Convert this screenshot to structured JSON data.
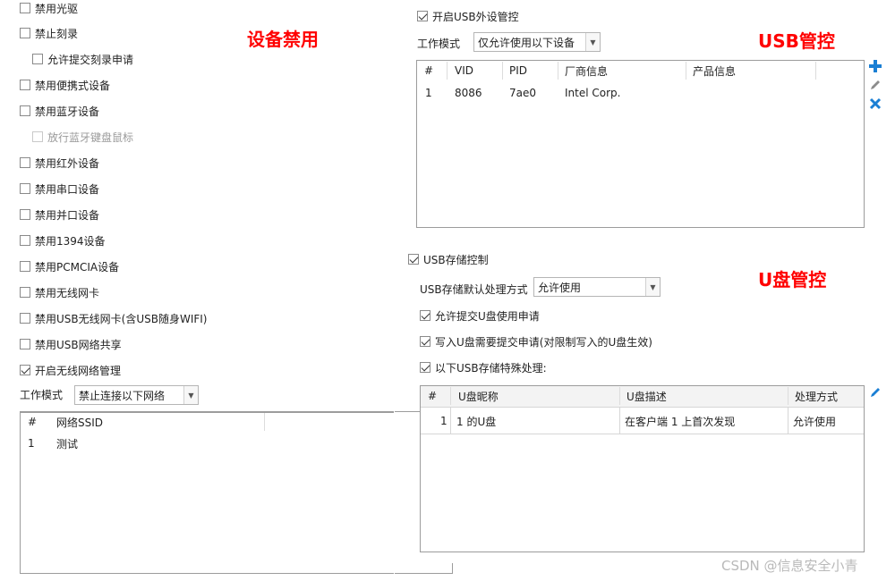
{
  "titles": {
    "device_disable": "设备禁用",
    "usb_control": "USB管控",
    "udisk_control": "U盘管控",
    "colors": {
      "title": "#ff0000",
      "accent_icon": "#1a7fd4"
    }
  },
  "left_checkboxes": [
    {
      "label": "禁用光驱",
      "checked": false,
      "disabled": false
    },
    {
      "label": "禁止刻录",
      "checked": false,
      "disabled": false
    },
    {
      "label": "允许提交刻录申请",
      "checked": false,
      "disabled": false
    },
    {
      "label": "禁用便携式设备",
      "checked": false,
      "disabled": false
    },
    {
      "label": "禁用蓝牙设备",
      "checked": false,
      "disabled": false
    },
    {
      "label": "放行蓝牙键盘鼠标",
      "checked": false,
      "disabled": true
    },
    {
      "label": "禁用红外设备",
      "checked": false,
      "disabled": false
    },
    {
      "label": "禁用串口设备",
      "checked": false,
      "disabled": false
    },
    {
      "label": "禁用并口设备",
      "checked": false,
      "disabled": false
    },
    {
      "label": "禁用1394设备",
      "checked": false,
      "disabled": false
    },
    {
      "label": "禁用PCMCIA设备",
      "checked": false,
      "disabled": false
    },
    {
      "label": "禁用无线网卡",
      "checked": false,
      "disabled": false
    },
    {
      "label": "禁用USB无线网卡(含USB随身WIFI)",
      "checked": false,
      "disabled": false
    },
    {
      "label": "禁用USB网络共享",
      "checked": false,
      "disabled": false
    },
    {
      "label": "开启无线网络管理",
      "checked": true,
      "disabled": false
    }
  ],
  "wifi": {
    "mode_label": "工作模式",
    "mode_value": "禁止连接以下网络",
    "columns": [
      "#",
      "网络SSID"
    ],
    "rows": [
      [
        "1",
        "测试"
      ]
    ]
  },
  "usb": {
    "enable_label": "开启USB外设管控",
    "mode_label": "工作模式",
    "mode_value": "仅允许使用以下设备",
    "columns": [
      "#",
      "VID",
      "PID",
      "厂商信息",
      "产品信息"
    ],
    "rows": [
      [
        "1",
        "8086",
        "7ae0",
        "Intel Corp.",
        ""
      ]
    ],
    "icons": {
      "add": "plus-icon",
      "edit": "pencil-icon",
      "delete": "x-icon"
    }
  },
  "storage": {
    "enable_label": "USB存储控制",
    "default_label": "USB存储默认处理方式",
    "default_value": "允许使用",
    "opt1": "允许提交U盘使用申请",
    "opt2": "写入U盘需要提交申请(对限制写入的U盘生效)",
    "opt3": "以下USB存储特殊处理:",
    "columns": [
      "#",
      "U盘昵称",
      "U盘描述",
      "处理方式"
    ],
    "rows": [
      [
        "1",
        "1 的U盘",
        "在客户端 1 上首次发现",
        "允许使用"
      ]
    ]
  },
  "watermark": "CSDN @信息安全小青"
}
